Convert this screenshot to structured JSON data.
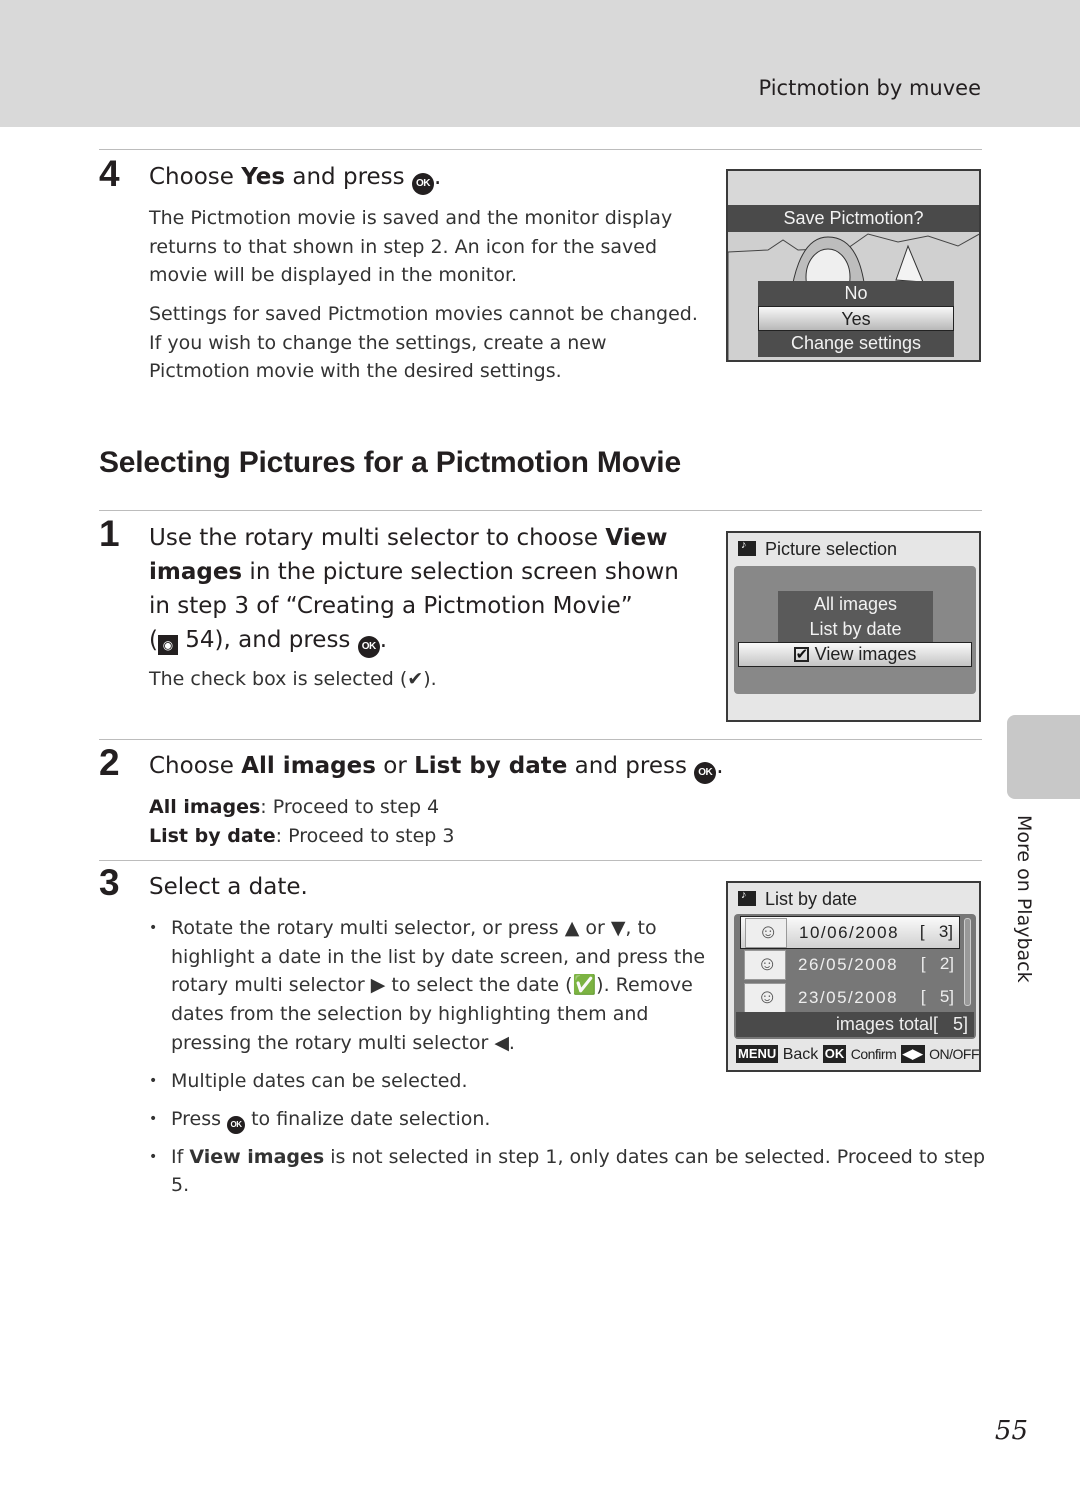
{
  "header": {
    "title": "Pictmotion by muvee"
  },
  "top_step": {
    "number": "4",
    "head_prefix": "Choose ",
    "head_bold": "Yes",
    "head_suffix": " and press ",
    "ok_icon": "OK",
    "para1": [
      "The Pictmotion movie is saved and the monitor display",
      "returns to that shown in step 2. An icon for the saved",
      "movie will be displayed in the monitor."
    ],
    "para2": [
      "Settings for saved Pictmotion movies cannot be changed.",
      "If you wish to change the settings, create a new",
      "Pictmotion movie with the desired settings."
    ]
  },
  "screen_save": {
    "title": "Save Pictmotion?",
    "options": [
      "No",
      "Yes",
      "Change settings"
    ],
    "selected": "Yes"
  },
  "section": {
    "title": "Selecting Pictures for a Pictmotion Movie"
  },
  "step1": {
    "number": "1",
    "line1_prefix": "Use the rotary multi selector to choose ",
    "line1_bold": "View",
    "line2_bold": "images",
    "line2_suffix": " in the picture selection screen shown",
    "line3": "in step 3 of “Creating a Pictmotion Movie”",
    "line4_open": "(",
    "ref_icon": "reference-icon",
    "line4_page": " 54), and press ",
    "note": "The check box is selected (✔)."
  },
  "screen_picture_selection": {
    "title": "Picture selection",
    "options": [
      "All images",
      "List by date"
    ],
    "selected": "View images",
    "checkbox_checked": true
  },
  "step2": {
    "number": "2",
    "head_prefix": "Choose ",
    "head_bold1": "All images",
    "head_mid": " or ",
    "head_bold2": "List by date",
    "head_suffix": " and press ",
    "line1_bold": "All images",
    "line1_text": ": Proceed to step 4",
    "line2_bold": "List by date",
    "line2_text": ": Proceed to step 3"
  },
  "step3": {
    "number": "3",
    "head": "Select a date.",
    "bullet1": [
      "Rotate the rotary multi selector, or press ▲ or ▼, to",
      "highlight a date in the list by date screen, and press the",
      "rotary multi selector ▶ to select the date (✅). Remove",
      "dates from the selection by highlighting them and",
      "pressing the rotary multi selector ◀."
    ],
    "bullet2": "Multiple dates can be selected.",
    "bullet3_prefix": "Press ",
    "bullet3_suffix": " to finalize date selection.",
    "bullet4_prefix": "If ",
    "bullet4_bold": "View images",
    "bullet4_suffix": " is not selected in step 1, only dates can be selected. Proceed to step 5."
  },
  "screen_list_by_date": {
    "title": "List by date",
    "rows": [
      {
        "date": "10/06/2008",
        "count": "[   3]",
        "selected": true
      },
      {
        "date": "26/05/2008",
        "count": "[   2]",
        "selected": false
      },
      {
        "date": "23/05/2008",
        "count": "[   5]",
        "selected": false
      }
    ],
    "total_label": "images total",
    "total_count": "[   5]",
    "footer": {
      "menu_key": "MENU",
      "back": "Back",
      "ok_key": "OK",
      "confirm": "Confirm",
      "arrows_key": "◀▶",
      "onoff": "ON/OFF"
    }
  },
  "side_tab": {
    "label": "More on Playback"
  },
  "page_number": "55"
}
